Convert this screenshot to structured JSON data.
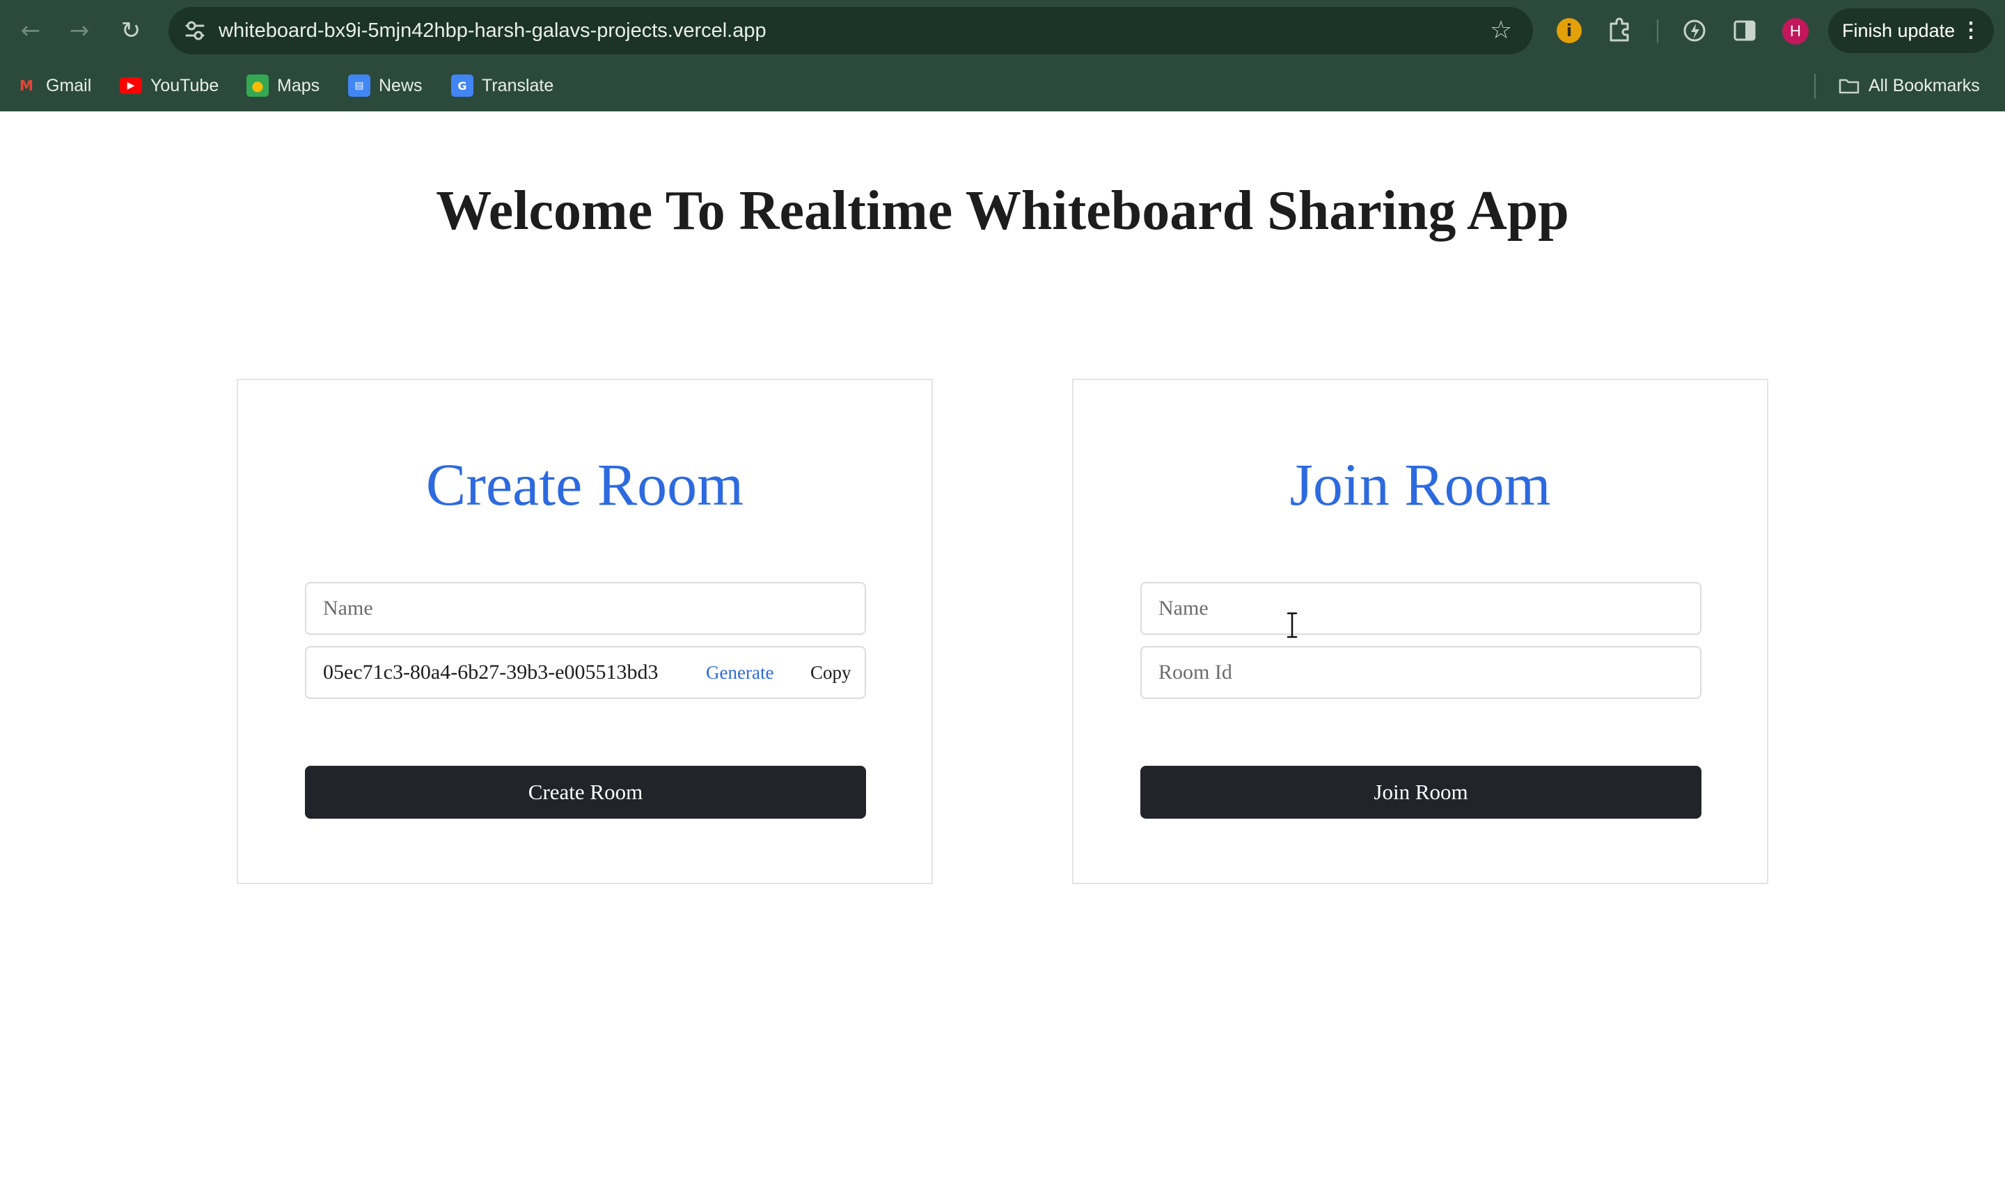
{
  "browser": {
    "url": "whiteboard-bx9i-5mjn42hbp-harsh-galavs-projects.vercel.app",
    "finish_update_label": "Finish update",
    "profile_initial": "H",
    "bookmarks": [
      {
        "label": "Gmail",
        "icon": "gmail-icon"
      },
      {
        "label": "YouTube",
        "icon": "youtube-icon"
      },
      {
        "label": "Maps",
        "icon": "maps-icon"
      },
      {
        "label": "News",
        "icon": "news-icon"
      },
      {
        "label": "Translate",
        "icon": "translate-icon"
      }
    ],
    "all_bookmarks_label": "All Bookmarks",
    "colors": {
      "chrome_bg": "#2c4a3c",
      "omnibox_bg": "#1c3328"
    }
  },
  "page": {
    "title": "Welcome To Realtime Whiteboard Sharing App",
    "accent_color": "#2d6adf"
  },
  "create_room": {
    "title": "Create Room",
    "name_placeholder": "Name",
    "room_id": "05ec71c3-80a4-6b27-39b3-e005513bd3",
    "generate_label": "Generate",
    "copy_label": "Copy",
    "submit_label": "Create Room"
  },
  "join_room": {
    "title": "Join Room",
    "name_placeholder": "Name",
    "room_id_placeholder": "Room Id",
    "submit_label": "Join Room"
  }
}
